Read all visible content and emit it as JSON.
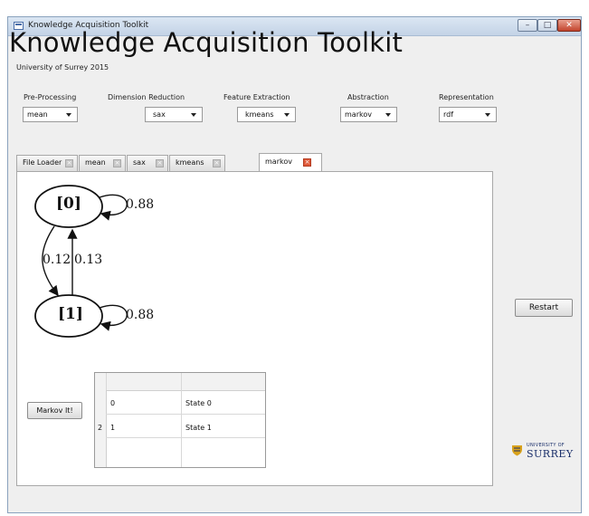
{
  "window": {
    "title": "Knowledge Acquisition Toolkit",
    "controls": {
      "minimize": "–",
      "maximize": "□",
      "close": "✕"
    }
  },
  "header": {
    "title": "Knowledge Acquisition Toolkit",
    "subtitle": "University of Surrey 2015"
  },
  "selectors": [
    {
      "label": "Pre-Processing",
      "value": "mean"
    },
    {
      "label": "Dimension Reduction",
      "value": "sax"
    },
    {
      "label": "Feature Extraction",
      "value": "kmeans"
    },
    {
      "label": "Abstraction",
      "value": "markov"
    },
    {
      "label": "Representation",
      "value": "rdf"
    }
  ],
  "tabs": [
    {
      "label": "File Loader",
      "active": false
    },
    {
      "label": "mean",
      "active": false
    },
    {
      "label": "sax",
      "active": false
    },
    {
      "label": "kmeans",
      "active": false
    },
    {
      "label": "markov",
      "active": true
    }
  ],
  "graph": {
    "states": [
      "[0]",
      "[1]"
    ],
    "self_loop_0": "0.88",
    "self_loop_1": "0.88",
    "edge_0_to_1": "0.12",
    "edge_1_to_0": "0.13"
  },
  "buttons": {
    "markov_it": "Markov It!",
    "restart": "Restart"
  },
  "table": {
    "row_header": "2",
    "rows": [
      {
        "id": "0",
        "label": "State 0"
      },
      {
        "id": "1",
        "label": "State 1"
      }
    ]
  },
  "logo": {
    "small": "UNIVERSITY OF",
    "big": "SURREY"
  },
  "colors": {
    "active_tab_close": "#e05a3a",
    "titlebar": "#c3d3e6",
    "logo_text": "#1a2f6a",
    "logo_shield": "#d9a21b"
  }
}
